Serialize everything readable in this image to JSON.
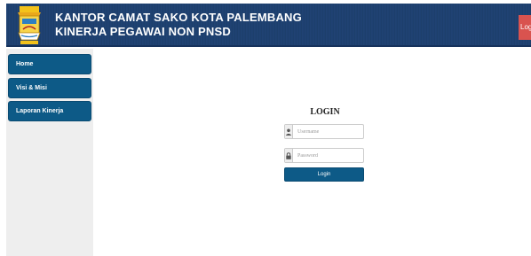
{
  "header": {
    "title_line1": "KANTOR CAMAT SAKO KOTA PALEMBANG",
    "title_line2": "KINERJA PEGAWAI NON PNSD",
    "logout_label": "Logout",
    "logo_icon": "palembang-crest-icon"
  },
  "sidebar": {
    "items": [
      {
        "label": "Home"
      },
      {
        "label": "Visi & Misi"
      },
      {
        "label": "Laporan Kinerja"
      }
    ]
  },
  "login": {
    "title": "LOGIN",
    "username_placeholder": "Username",
    "username_icon": "user-icon",
    "password_placeholder": "Password",
    "password_icon": "lock-icon",
    "button_label": "Login"
  },
  "colors": {
    "header_bg": "#1c3d6e",
    "nav_bg": "#0d5a87",
    "sidebar_bg": "#eeeeee",
    "logout_bg": "#d9534f"
  }
}
